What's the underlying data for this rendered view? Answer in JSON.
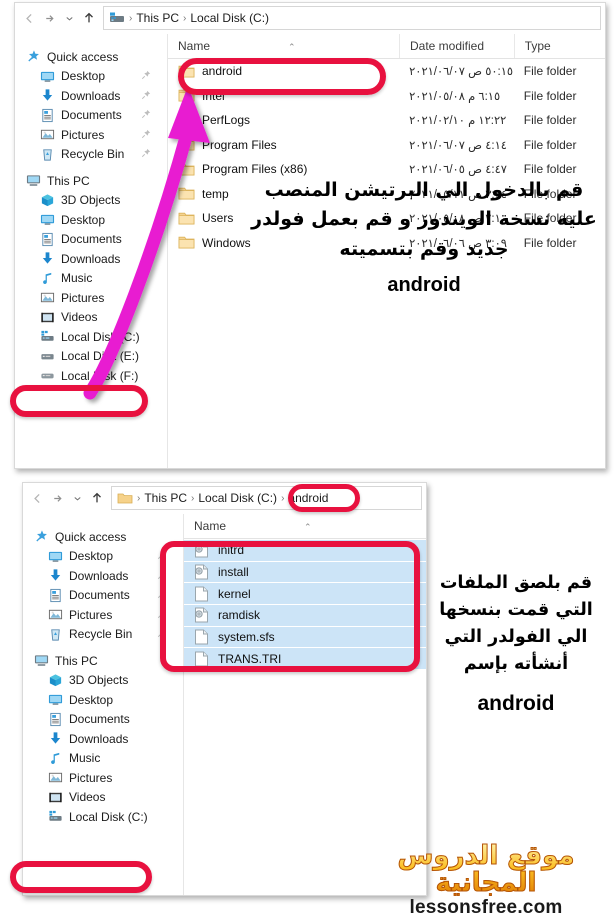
{
  "accent": {
    "highlight_oval": "#e8113f",
    "arrow": "#e81ed1",
    "selection": "#cce4f7",
    "watermark_gold": "#fbbf24"
  },
  "top_window": {
    "nav_buttons": {
      "back": "back-arrow",
      "forward": "forward-arrow",
      "recent": "chevron-down",
      "up": "up-arrow"
    },
    "breadcrumb": {
      "icon": "computer-icon",
      "items": [
        "This PC",
        "Local Disk (C:)"
      ],
      "separator": "›"
    },
    "columns": [
      "Name",
      "Date modified",
      "Type"
    ],
    "sort_caret": "⌃",
    "rows": [
      {
        "name": "android",
        "date": "٥٠:١٥ ص ٢٠٢١/٠٦/٠٧",
        "type": "File folder"
      },
      {
        "name": "Intel",
        "date": "٦:١٥ م ٢٠٢١/٠٥/٠٨",
        "type": "File folder"
      },
      {
        "name": "PerfLogs",
        "date": "١٢:٢٢ م ٢٠٢١/٠٢/١٠",
        "type": "File folder"
      },
      {
        "name": "Program Files",
        "date": "٤:١٤ ص ٢٠٢١/٠٦/٠٧",
        "type": "File folder"
      },
      {
        "name": "Program Files (x86)",
        "date": "٤:٤٧ ص ٢٠٢١/٠٦/٠٥",
        "type": "File folder"
      },
      {
        "name": "temp",
        "date": "٣:٢٤ ص ٢٠٢١/٠٥/١١",
        "type": "File folder"
      },
      {
        "name": "Users",
        "date": "٢:١٠ ص ٢٠٢١/٠٥/٠٨",
        "type": "File folder"
      },
      {
        "name": "Windows",
        "date": "٣:٠٩ ص ٢٠٢١/٠٦/٠٦",
        "type": "File folder"
      }
    ],
    "nav_pane": {
      "quick_access": {
        "label": "Quick access",
        "icon": "star-pin-icon"
      },
      "quick_items": [
        {
          "label": "Desktop",
          "icon": "desktop-icon",
          "pinned": true
        },
        {
          "label": "Downloads",
          "icon": "download-icon",
          "pinned": true
        },
        {
          "label": "Documents",
          "icon": "documents-icon",
          "pinned": true
        },
        {
          "label": "Pictures",
          "icon": "pictures-icon",
          "pinned": true
        },
        {
          "label": "Recycle Bin",
          "icon": "recycle-bin-icon",
          "pinned": true
        }
      ],
      "this_pc": {
        "label": "This PC",
        "icon": "this-pc-icon"
      },
      "pc_items": [
        {
          "label": "3D Objects",
          "icon": "3d-objects-icon"
        },
        {
          "label": "Desktop",
          "icon": "desktop-icon"
        },
        {
          "label": "Documents",
          "icon": "documents-icon"
        },
        {
          "label": "Downloads",
          "icon": "download-icon"
        },
        {
          "label": "Music",
          "icon": "music-icon"
        },
        {
          "label": "Pictures",
          "icon": "pictures-icon"
        },
        {
          "label": "Videos",
          "icon": "videos-icon"
        }
      ],
      "drives": [
        {
          "label": "Local Disk (C:)",
          "icon": "system-drive-icon",
          "highlighted": true
        },
        {
          "label": "Local Disk (E:)",
          "icon": "drive-icon"
        },
        {
          "label": "Local Disk (F:)",
          "icon": "drive-icon"
        }
      ]
    }
  },
  "bottom_window": {
    "breadcrumb": {
      "icon": "folder-icon",
      "items": [
        "This PC",
        "Local Disk (C:)",
        "android"
      ],
      "separator": "›"
    },
    "columns": [
      "Name"
    ],
    "sort_caret": "⌃",
    "rows": [
      {
        "name": "initrd",
        "icon": "disc-file-icon"
      },
      {
        "name": "install",
        "icon": "disc-file-icon"
      },
      {
        "name": "kernel",
        "icon": "generic-file-icon"
      },
      {
        "name": "ramdisk",
        "icon": "disc-file-icon"
      },
      {
        "name": "system.sfs",
        "icon": "generic-file-icon"
      },
      {
        "name": "TRANS.TRI",
        "icon": "generic-file-icon"
      }
    ],
    "nav_pane": {
      "quick_access": {
        "label": "Quick access",
        "icon": "star-pin-icon"
      },
      "quick_items": [
        {
          "label": "Desktop",
          "icon": "desktop-icon",
          "pinned": true
        },
        {
          "label": "Downloads",
          "icon": "download-icon",
          "pinned": true
        },
        {
          "label": "Documents",
          "icon": "documents-icon",
          "pinned": true
        },
        {
          "label": "Pictures",
          "icon": "pictures-icon",
          "pinned": true
        },
        {
          "label": "Recycle Bin",
          "icon": "recycle-bin-icon",
          "pinned": true
        }
      ],
      "this_pc": {
        "label": "This PC",
        "icon": "this-pc-icon"
      },
      "pc_items": [
        {
          "label": "3D Objects",
          "icon": "3d-objects-icon"
        },
        {
          "label": "Desktop",
          "icon": "desktop-icon"
        },
        {
          "label": "Documents",
          "icon": "documents-icon"
        },
        {
          "label": "Downloads",
          "icon": "download-icon"
        },
        {
          "label": "Music",
          "icon": "music-icon"
        },
        {
          "label": "Pictures",
          "icon": "pictures-icon"
        },
        {
          "label": "Videos",
          "icon": "videos-icon"
        }
      ],
      "drives": [
        {
          "label": "Local Disk (C:)",
          "icon": "system-drive-icon",
          "highlighted": true
        }
      ]
    }
  },
  "annotations": {
    "top": {
      "line1": "قم بالدخول الي البرتيشن المنصب",
      "line2": "عليه نسخة الويندوز و قم بعمل فولدر",
      "line3": "جديد وقم بتسميته",
      "latin": "android"
    },
    "bottom": {
      "line1": "قم بلصق الملفات",
      "line2": "التي قمت بنسخها",
      "line3": "الي الفولدر التي",
      "line4": "أنشأته بإسم",
      "latin": "android"
    }
  },
  "watermark": {
    "arabic": "موقع الدروس المجانية",
    "site": "lessonsfree.com"
  }
}
